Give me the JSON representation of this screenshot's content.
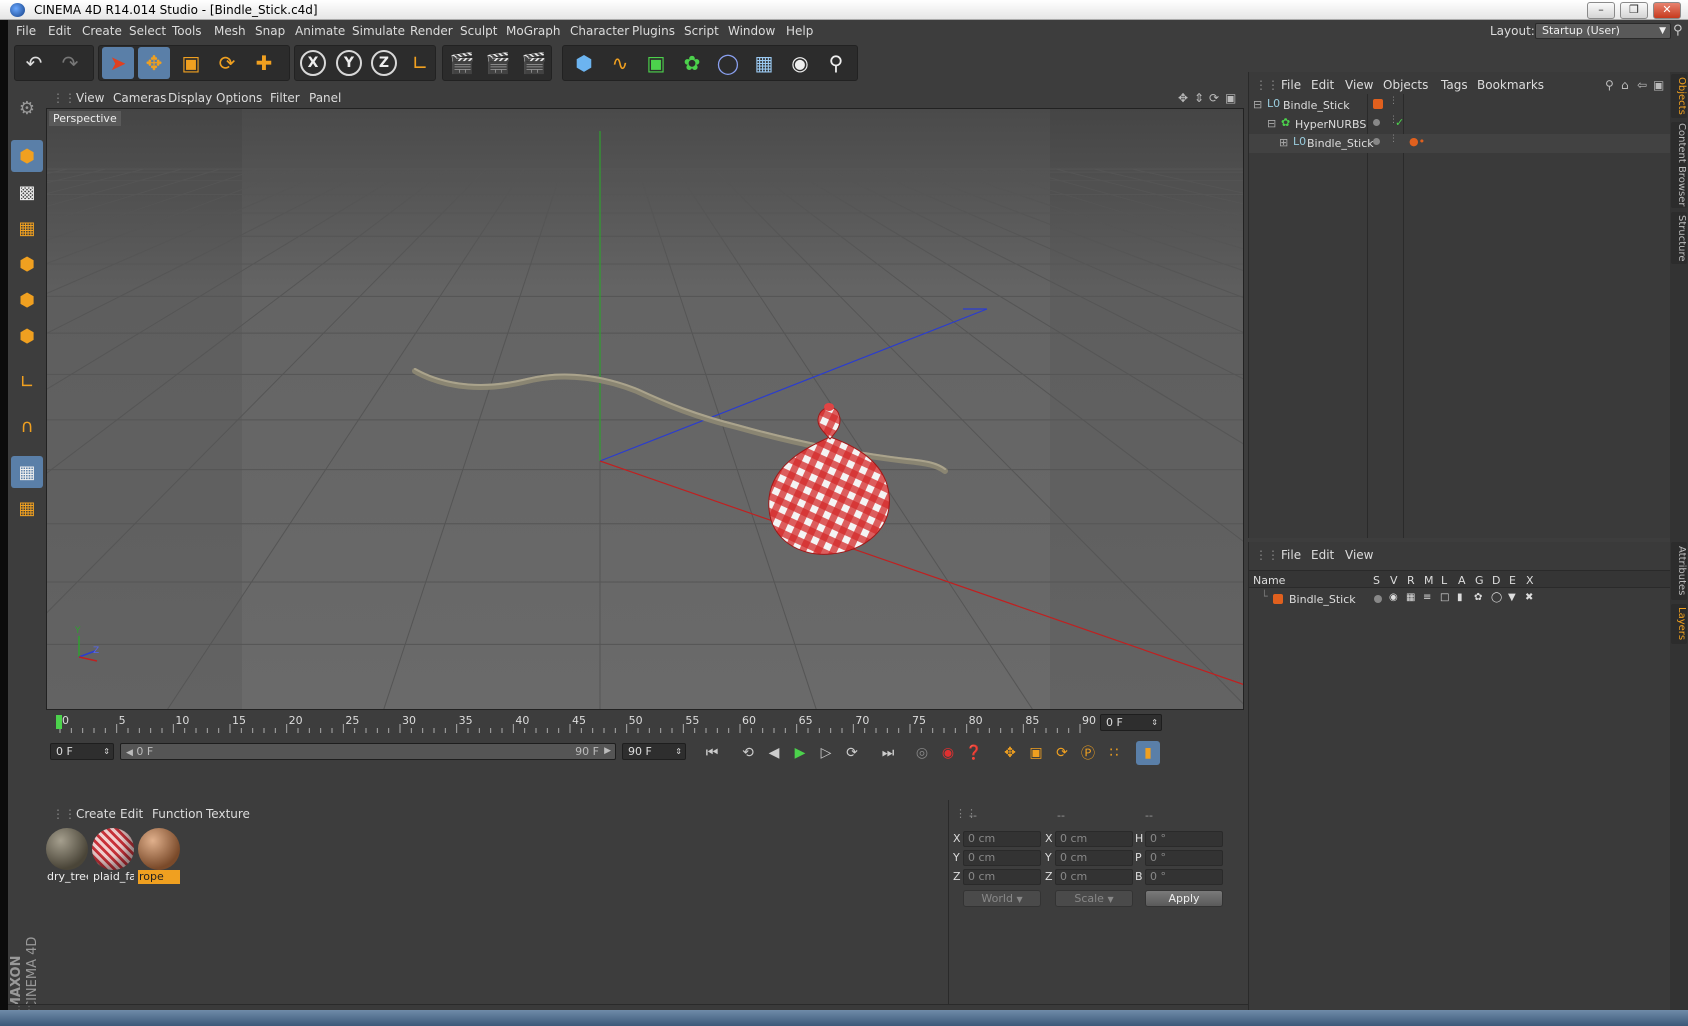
{
  "window": {
    "title": "CINEMA 4D R14.014 Studio - [Bindle_Stick.c4d]"
  },
  "menubar": {
    "items": [
      "File",
      "Edit",
      "Create",
      "Select",
      "Tools",
      "Mesh",
      "Snap",
      "Animate",
      "Simulate",
      "Render",
      "Sculpt",
      "MoGraph",
      "Character",
      "Plugins",
      "Script",
      "Window",
      "Help"
    ],
    "layout_label": "Layout:",
    "layout_value": "Startup (User)"
  },
  "viewport": {
    "menu": [
      "View",
      "Cameras",
      "Display",
      "Options",
      "Filter",
      "Panel"
    ],
    "label": "Perspective",
    "axis": {
      "y": "Y",
      "z": "Z"
    }
  },
  "timeline": {
    "ticks": [
      "0",
      "5",
      "10",
      "15",
      "20",
      "25",
      "30",
      "35",
      "40",
      "45",
      "50",
      "55",
      "60",
      "65",
      "70",
      "75",
      "80",
      "85",
      "90"
    ],
    "current_frame": "0 F",
    "start_frame": "0 F",
    "range_start": "0 F",
    "range_end": "90 F",
    "end_frame": "90 F"
  },
  "materials": {
    "menu": [
      "Create",
      "Edit",
      "Function",
      "Texture"
    ],
    "items": [
      {
        "name": "dry_tree",
        "color": "#6a6455",
        "selected": false
      },
      {
        "name": "plaid_fa",
        "color": "#c8323a",
        "selected": false
      },
      {
        "name": "rope",
        "color": "#a4704a",
        "selected": true
      }
    ]
  },
  "coordinates": {
    "headers": [
      "--",
      "--",
      "--"
    ],
    "rows": [
      {
        "l1": "X",
        "v1": "0 cm",
        "l2": "X",
        "v2": "0 cm",
        "l3": "H",
        "v3": "0 °"
      },
      {
        "l1": "Y",
        "v1": "0 cm",
        "l2": "Y",
        "v2": "0 cm",
        "l3": "P",
        "v3": "0 °"
      },
      {
        "l1": "Z",
        "v1": "0 cm",
        "l2": "Z",
        "v2": "0 cm",
        "l3": "B",
        "v3": "0 °"
      }
    ],
    "space_select": "World",
    "mode_select": "Scale",
    "apply_label": "Apply"
  },
  "object_manager": {
    "menu": [
      "File",
      "Edit",
      "View",
      "Objects",
      "Tags",
      "Bookmarks"
    ],
    "objects": [
      {
        "name": "Bindle_Stick",
        "indent": 0
      },
      {
        "name": "HyperNURBS",
        "indent": 1
      },
      {
        "name": "Bindle_Stick",
        "indent": 2
      }
    ]
  },
  "layer_manager": {
    "menu": [
      "File",
      "Edit",
      "View"
    ],
    "columns": [
      "Name",
      "S",
      "V",
      "R",
      "M",
      "L",
      "A",
      "G",
      "D",
      "E",
      "X"
    ],
    "layers": [
      {
        "name": "Bindle_Stick",
        "color": "#e0601e"
      }
    ]
  },
  "side_tabs": [
    "Objects",
    "Content Browser",
    "Structure",
    "Attributes",
    "Layers"
  ],
  "branding": {
    "maxon": "MAXON",
    "product": "CINEMA 4D"
  },
  "colors": {
    "accent_orange": "#f0a020",
    "selection_blue": "#5a7fa8",
    "play_green": "#4cd24c"
  }
}
